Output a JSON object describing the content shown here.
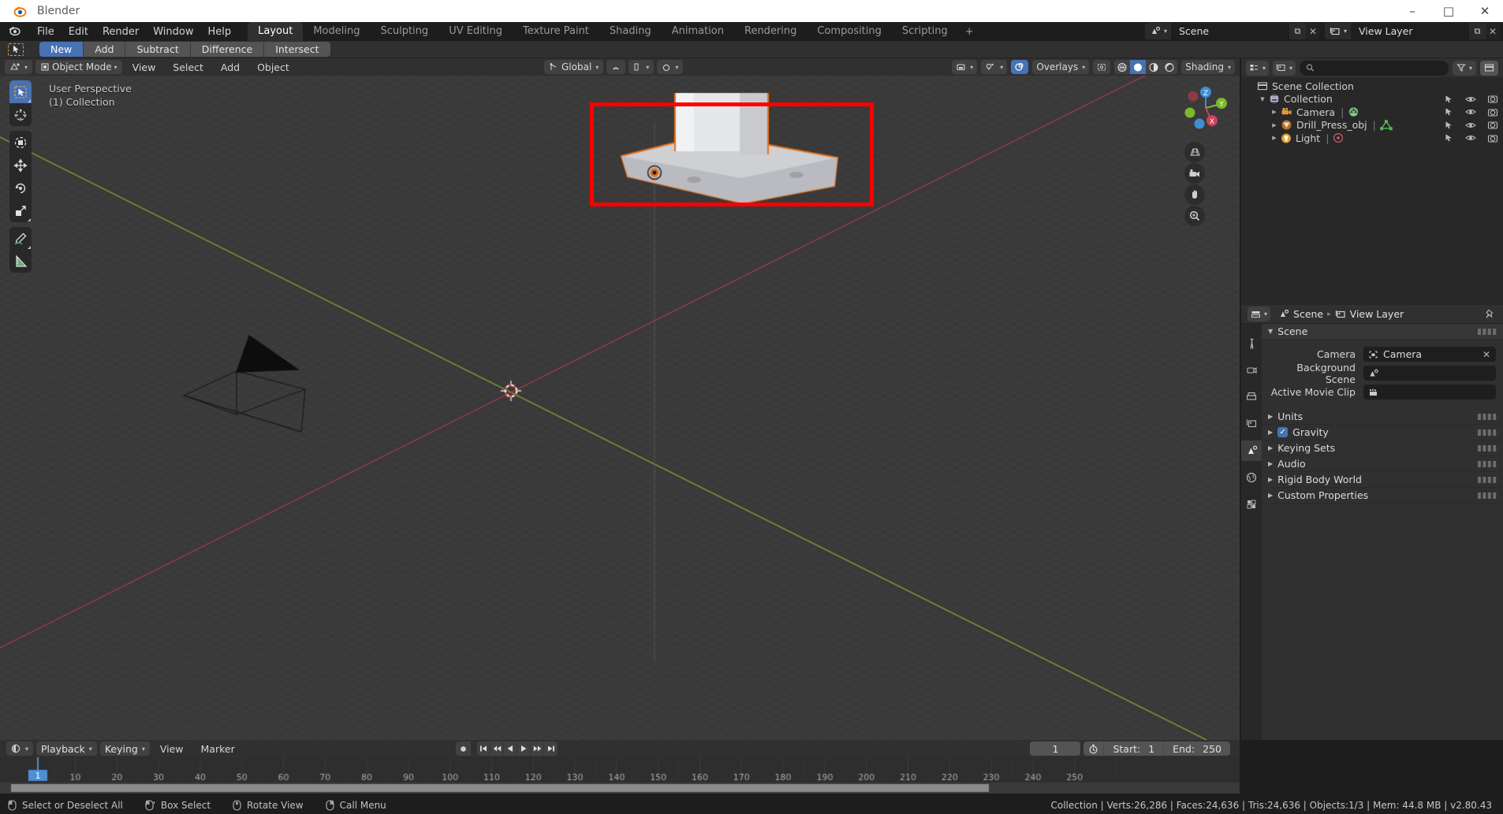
{
  "window": {
    "app_title": "Blender",
    "app_icon": "blender-logo-icon",
    "minimize": "–",
    "maximize": "□",
    "close": "✕"
  },
  "topbar": {
    "menus": [
      "File",
      "Edit",
      "Render",
      "Window",
      "Help"
    ],
    "workspaces": [
      {
        "label": "Layout",
        "active": true
      },
      {
        "label": "Modeling",
        "active": false
      },
      {
        "label": "Sculpting",
        "active": false
      },
      {
        "label": "UV Editing",
        "active": false
      },
      {
        "label": "Texture Paint",
        "active": false
      },
      {
        "label": "Shading",
        "active": false
      },
      {
        "label": "Animation",
        "active": false
      },
      {
        "label": "Rendering",
        "active": false
      },
      {
        "label": "Compositing",
        "active": false
      },
      {
        "label": "Scripting",
        "active": false
      }
    ],
    "add_workspace": "+",
    "scene": {
      "icon": "scene-icon",
      "name": "Scene",
      "new_btn": "⧉",
      "unlink_btn": "✕"
    },
    "view_layer": {
      "icon": "view-layer-icon",
      "name": "View Layer",
      "new_btn": "⧉",
      "unlink_btn": "✕"
    }
  },
  "tool_settings": {
    "active_tool_icon": "select-box-cursor-icon",
    "boolean_modes": [
      {
        "label": "New",
        "active": true
      },
      {
        "label": "Add",
        "active": false
      },
      {
        "label": "Subtract",
        "active": false
      },
      {
        "label": "Difference",
        "active": false
      },
      {
        "label": "Intersect",
        "active": false
      }
    ]
  },
  "viewport": {
    "editor_type_icon": "editor-type-3dview-icon",
    "mode": "Object Mode",
    "menus": [
      "View",
      "Select",
      "Add",
      "Object"
    ],
    "transform_orientation": {
      "icon": "orientation-icon",
      "label": "Global"
    },
    "snap_icon": "magnet-icon",
    "snap_target_icon": "snap-increment-icon",
    "proportional_icon": "proportional-editing-icon",
    "overlay_label": "Overlays",
    "gizmo_icon": "gizmo-icon",
    "visibility_icon": "object-visibility-icon",
    "shading_label": "Shading",
    "shading_modes": [
      {
        "name": "wireframe-shading",
        "active": false
      },
      {
        "name": "solid-shading",
        "active": true
      },
      {
        "name": "material-preview-shading",
        "active": false
      },
      {
        "name": "rendered-shading",
        "active": false
      }
    ],
    "overlay_text": [
      "User Perspective",
      "(1) Collection"
    ],
    "toolbar": [
      {
        "name": "tweak-tool",
        "icon": "cursor-arrow-icon",
        "active": true
      },
      {
        "name": "cursor-tool",
        "icon": "3d-cursor-icon",
        "active": false
      },
      {
        "name": "transform-tool",
        "icon": "transform-icon",
        "active": false
      },
      {
        "name": "move-tool",
        "icon": "move-arrows-icon",
        "active": false
      },
      {
        "name": "rotate-tool",
        "icon": "rotate-icon",
        "active": false
      },
      {
        "name": "scale-tool",
        "icon": "scale-icon",
        "active": false
      },
      {
        "name": "annotate-tool",
        "icon": "pencil-icon",
        "active": false
      },
      {
        "name": "measure-tool",
        "icon": "ruler-icon",
        "active": false
      }
    ],
    "nav_buttons": [
      {
        "name": "toggle-perspective-button",
        "icon": "grid-perspective-icon"
      },
      {
        "name": "toggle-camera-view-button",
        "icon": "camera-icon"
      },
      {
        "name": "move-view-button",
        "icon": "hand-icon"
      },
      {
        "name": "zoom-view-button",
        "icon": "magnifier-icon"
      }
    ],
    "axis_gizmo": {
      "z": "Z",
      "y": "Y",
      "x": "X"
    },
    "highlight_color": "#fe0000"
  },
  "outliner": {
    "display_mode_icon": "outliner-display-mode-icon",
    "filter_id_icon": "scene-data-icon",
    "search_placeholder": "",
    "search_value": "",
    "filter_icon": "funnel-icon",
    "new_collection_icon": "new-collection-icon",
    "rows": [
      {
        "indent": 0,
        "disclosure": "",
        "icon": "scene-collection-icon",
        "name": "Scene Collection",
        "badge": "",
        "has_toggles": false
      },
      {
        "indent": 1,
        "disclosure": "▼",
        "icon": "collection-icon",
        "name": "Collection",
        "badge": "",
        "has_toggles": true
      },
      {
        "indent": 2,
        "disclosure": "▶",
        "icon": "camera-object-icon",
        "name": "Camera",
        "badge": "camera-data-icon",
        "has_toggles": true
      },
      {
        "indent": 2,
        "disclosure": "▶",
        "icon": "mesh-object-icon",
        "name": "Drill_Press_obj",
        "badge": "mesh-data-icon",
        "has_toggles": true
      },
      {
        "indent": 2,
        "disclosure": "▶",
        "icon": "light-object-icon",
        "name": "Light",
        "badge": "light-data-icon",
        "has_toggles": true
      }
    ],
    "toggle_icons": [
      "select-arrow-icon",
      "eye-icon",
      "camera-render-icon"
    ]
  },
  "properties": {
    "editor_type_icon": "editor-type-properties-icon",
    "breadcrumb": [
      {
        "icon": "scene-icon",
        "label": "Scene"
      },
      {
        "icon": "view-layer-icon",
        "label": "View Layer"
      }
    ],
    "pin_icon": "pin-icon",
    "tabs": [
      {
        "name": "tool-tab",
        "icon": "tool-wrench-icon",
        "active": false
      },
      {
        "name": "render-tab",
        "icon": "render-camera-icon",
        "active": false
      },
      {
        "name": "output-tab",
        "icon": "output-printer-icon",
        "active": false
      },
      {
        "name": "view-layer-tab",
        "icon": "view-layer-images-icon",
        "active": false
      },
      {
        "name": "scene-tab",
        "icon": "scene-cone-icon",
        "active": true
      },
      {
        "name": "world-tab",
        "icon": "world-globe-icon",
        "active": false
      },
      {
        "name": "texture-tab",
        "icon": "texture-checker-icon",
        "active": false
      }
    ],
    "panels": [
      {
        "label": "Scene",
        "open": true,
        "checkbox": null
      },
      {
        "label": "Units",
        "open": false,
        "checkbox": null
      },
      {
        "label": "Gravity",
        "open": false,
        "checkbox": true
      },
      {
        "label": "Keying Sets",
        "open": false,
        "checkbox": null
      },
      {
        "label": "Audio",
        "open": false,
        "checkbox": null
      },
      {
        "label": "Rigid Body World",
        "open": false,
        "checkbox": null
      },
      {
        "label": "Custom Properties",
        "open": false,
        "checkbox": null
      }
    ],
    "scene_fields": [
      {
        "label": "Camera",
        "icon": "camera-object-icon",
        "value": "Camera",
        "clear": "✕"
      },
      {
        "label": "Background Scene",
        "icon": "scene-icon",
        "value": "",
        "clear": ""
      },
      {
        "label": "Active Movie Clip",
        "icon": "movie-clip-icon",
        "value": "",
        "clear": ""
      }
    ]
  },
  "timeline": {
    "editor_type_icon": "editor-type-timeline-icon",
    "dropdowns": [
      "Playback",
      "Keying"
    ],
    "menus": [
      "View",
      "Marker"
    ],
    "transport": [
      {
        "name": "record-keyframes-button",
        "icon": "record-dot-icon"
      },
      {
        "name": "jump-to-start-button",
        "icon": "jump-start-icon"
      },
      {
        "name": "previous-keyframe-button",
        "icon": "prev-keyframe-icon"
      },
      {
        "name": "play-reverse-button",
        "icon": "play-reverse-icon"
      },
      {
        "name": "play-button",
        "icon": "play-icon"
      },
      {
        "name": "next-keyframe-button",
        "icon": "next-keyframe-icon"
      },
      {
        "name": "jump-to-end-button",
        "icon": "jump-end-icon"
      }
    ],
    "current_frame": "1",
    "autokey_icon": "stopwatch-icon",
    "start_label": "Start:",
    "start_value": "1",
    "end_label": "End:",
    "end_value": "250",
    "playhead_frame": "1",
    "ruler_ticks": [
      10,
      20,
      30,
      40,
      50,
      60,
      70,
      80,
      90,
      100,
      110,
      120,
      130,
      140,
      150,
      160,
      170,
      180,
      190,
      200,
      210,
      220,
      230,
      240,
      250
    ]
  },
  "statusbar": {
    "hints": [
      {
        "icon": "mouse-left-icon",
        "label": "Select or Deselect All"
      },
      {
        "icon": "mouse-left-drag-icon",
        "label": "Box Select"
      },
      {
        "icon": "mouse-middle-icon",
        "label": "Rotate View"
      },
      {
        "icon": "mouse-right-icon",
        "label": "Call Menu"
      }
    ],
    "stats": "Collection | Verts:26,286 | Faces:24,636 | Tris:24,636 | Objects:1/3 | Mem: 44.8 MB | v2.80.43"
  }
}
